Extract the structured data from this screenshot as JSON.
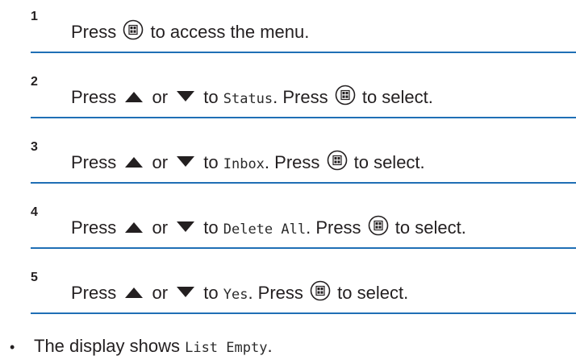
{
  "steps": [
    {
      "number": "1",
      "parts": [
        {
          "type": "text",
          "value": "Press "
        },
        {
          "type": "icon",
          "icon": "menu-ok-button-icon"
        },
        {
          "type": "text",
          "value": " to access the menu."
        }
      ]
    },
    {
      "number": "2",
      "parts": [
        {
          "type": "text",
          "value": "Press "
        },
        {
          "type": "icon",
          "icon": "up-arrow-icon"
        },
        {
          "type": "text",
          "value": " or "
        },
        {
          "type": "icon",
          "icon": "down-arrow-icon"
        },
        {
          "type": "text",
          "value": " to "
        },
        {
          "type": "mono",
          "value": "Status"
        },
        {
          "type": "text",
          "value": ". Press "
        },
        {
          "type": "icon",
          "icon": "menu-ok-button-icon"
        },
        {
          "type": "text",
          "value": " to select."
        }
      ]
    },
    {
      "number": "3",
      "parts": [
        {
          "type": "text",
          "value": "Press "
        },
        {
          "type": "icon",
          "icon": "up-arrow-icon"
        },
        {
          "type": "text",
          "value": " or "
        },
        {
          "type": "icon",
          "icon": "down-arrow-icon"
        },
        {
          "type": "text",
          "value": " to "
        },
        {
          "type": "mono",
          "value": "Inbox"
        },
        {
          "type": "text",
          "value": ". Press "
        },
        {
          "type": "icon",
          "icon": "menu-ok-button-icon"
        },
        {
          "type": "text",
          "value": " to select."
        }
      ]
    },
    {
      "number": "4",
      "parts": [
        {
          "type": "text",
          "value": "Press "
        },
        {
          "type": "icon",
          "icon": "up-arrow-icon"
        },
        {
          "type": "text",
          "value": " or "
        },
        {
          "type": "icon",
          "icon": "down-arrow-icon"
        },
        {
          "type": "text",
          "value": " to "
        },
        {
          "type": "mono",
          "value": "Delete All"
        },
        {
          "type": "text",
          "value": ". Press "
        },
        {
          "type": "icon",
          "icon": "menu-ok-button-icon"
        },
        {
          "type": "text",
          "value": " to select."
        }
      ]
    },
    {
      "number": "5",
      "parts": [
        {
          "type": "text",
          "value": "Press "
        },
        {
          "type": "icon",
          "icon": "up-arrow-icon"
        },
        {
          "type": "text",
          "value": " or "
        },
        {
          "type": "icon",
          "icon": "down-arrow-icon"
        },
        {
          "type": "text",
          "value": " to "
        },
        {
          "type": "mono",
          "value": "Yes"
        },
        {
          "type": "text",
          "value": ". Press "
        },
        {
          "type": "icon",
          "icon": "menu-ok-button-icon"
        },
        {
          "type": "text",
          "value": " to select."
        }
      ]
    }
  ],
  "result": {
    "bullet": "•",
    "text": "The display shows ",
    "mono": "List Empty",
    "end": "."
  },
  "colors": {
    "divider": "#1f6fb5",
    "text": "#231f20"
  }
}
